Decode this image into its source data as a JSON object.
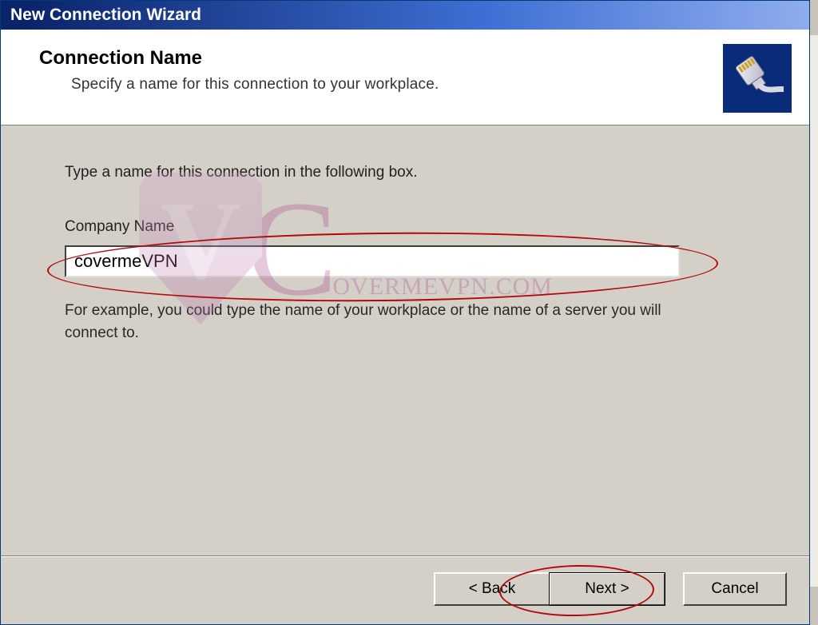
{
  "window": {
    "title": "New Connection Wizard"
  },
  "header": {
    "title": "Connection Name",
    "subtitle": "Specify a name for this connection to your workplace."
  },
  "content": {
    "instruction": "Type a name for this connection in the following box.",
    "field_label": "Company Name",
    "field_value": "covermeVPN",
    "example_text": "For example, you could type the name of your workplace or the name of a server you will connect to."
  },
  "buttons": {
    "back": "< Back",
    "next": "Next >",
    "cancel": "Cancel"
  },
  "watermark": {
    "label": "OVERMEVPN.COM",
    "letter": "C"
  },
  "icon": {
    "name": "network-rj45-cable-icon"
  }
}
